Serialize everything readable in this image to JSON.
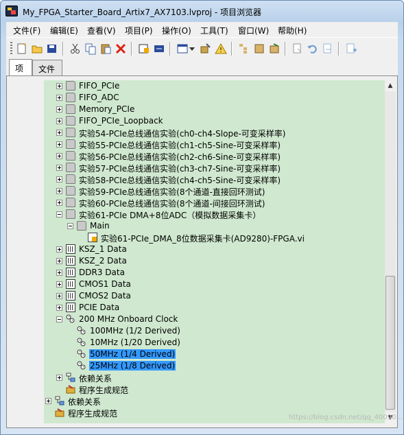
{
  "window": {
    "title": "My_FPGA_Starter_Board_Artix7_AX7103.lvproj - 项目浏览器"
  },
  "menu": [
    "文件(F)",
    "编辑(E)",
    "查看(V)",
    "项目(P)",
    "操作(O)",
    "工具(T)",
    "窗口(W)",
    "帮助(H)"
  ],
  "toolbar": [
    "new-icon",
    "open-icon",
    "save-all-icon",
    "cut-icon",
    "copy-icon",
    "paste-icon",
    "delete-icon",
    "build-icon",
    "deploy-icon",
    "view-icon",
    "dropdown-icon",
    "filter-icon",
    "warning-icon",
    "tree1-icon",
    "tree2-icon",
    "tree3-icon",
    "refresh-icon",
    "undo-icon",
    "redo-icon",
    "add-icon"
  ],
  "tabs": [
    "项",
    "文件"
  ],
  "tree": [
    {
      "label": "FIFO_PCIe",
      "icon": "folder",
      "level": 2,
      "exp": "plus"
    },
    {
      "label": "FIFO_ADC",
      "icon": "folder",
      "level": 2,
      "exp": "plus"
    },
    {
      "label": "Memory_PCIe",
      "icon": "folder",
      "level": 2,
      "exp": "plus"
    },
    {
      "label": "FIFO_PCIe_Loopback",
      "icon": "folder",
      "level": 2,
      "exp": "plus"
    },
    {
      "label": "实验54-PCIe总线通信实验(ch0-ch4-Slope-可变采样率)",
      "icon": "folder",
      "level": 2,
      "exp": "plus"
    },
    {
      "label": "实验55-PCIe总线通信实验(ch1-ch5-Sine-可变采样率)",
      "icon": "folder",
      "level": 2,
      "exp": "plus"
    },
    {
      "label": "实验56-PCIe总线通信实验(ch2-ch6-Sine-可变采样率)",
      "icon": "folder",
      "level": 2,
      "exp": "plus"
    },
    {
      "label": "实验57-PCIe总线通信实验(ch3-ch7-Sine-可变采样率)",
      "icon": "folder",
      "level": 2,
      "exp": "plus"
    },
    {
      "label": "实验58-PCIe总线通信实验(ch4-ch5-Sine-可变采样率)",
      "icon": "folder",
      "level": 2,
      "exp": "plus"
    },
    {
      "label": "实验59-PCIe总线通信实验(8个通道-直接回环测试)",
      "icon": "folder",
      "level": 2,
      "exp": "plus"
    },
    {
      "label": "实验60-PCIe总线通信实验(8个通道-间接回环测试)",
      "icon": "folder",
      "level": 2,
      "exp": "plus"
    },
    {
      "label": "实验61-PCIe DMA+8位ADC（模拟数据采集卡）",
      "icon": "folder",
      "level": 2,
      "exp": "minus"
    },
    {
      "label": "Main",
      "icon": "folder",
      "level": 3,
      "exp": "minus"
    },
    {
      "label": "实验61-PCIe_DMA_8位数据采集卡(AD9280)-FPGA.vi",
      "icon": "vi",
      "level": 4,
      "exp": ""
    },
    {
      "label": "KSZ_1 Data",
      "icon": "chip",
      "level": 2,
      "exp": "plus"
    },
    {
      "label": "KSZ_2 Data",
      "icon": "chip",
      "level": 2,
      "exp": "plus"
    },
    {
      "label": "DDR3 Data",
      "icon": "chip",
      "level": 2,
      "exp": "plus"
    },
    {
      "label": "CMOS1 Data",
      "icon": "chip",
      "level": 2,
      "exp": "plus"
    },
    {
      "label": "CMOS2 Data",
      "icon": "chip",
      "level": 2,
      "exp": "plus"
    },
    {
      "label": "PCIE Data",
      "icon": "chip",
      "level": 2,
      "exp": "plus"
    },
    {
      "label": "200 MHz Onboard Clock",
      "icon": "clock",
      "level": 2,
      "exp": "minus"
    },
    {
      "label": "100MHz (1/2 Derived)",
      "icon": "clock",
      "level": 3,
      "exp": "",
      "selected": false
    },
    {
      "label": "10MHz (1/20 Derived)",
      "icon": "clock",
      "level": 3,
      "exp": "",
      "selected": false
    },
    {
      "label": "50MHz (1/4 Derived)",
      "icon": "clock",
      "level": 3,
      "exp": "",
      "selected": true
    },
    {
      "label": "25MHz (1/8 Derived)",
      "icon": "clock",
      "level": 3,
      "exp": "",
      "selected": true
    },
    {
      "label": "依赖关系",
      "icon": "deps",
      "level": 2,
      "exp": "plus"
    },
    {
      "label": "程序生成规范",
      "icon": "build",
      "level": 2,
      "exp": ""
    },
    {
      "label": "依赖关系",
      "icon": "deps",
      "level": 1,
      "exp": "plus"
    },
    {
      "label": "程序生成规范",
      "icon": "build",
      "level": 1,
      "exp": ""
    }
  ],
  "watermark": "https://blog.csdn.net/qq_40090...",
  "colors": {
    "tree_bg": "#cfe8cf",
    "selection": "#3399ff",
    "titlebar": "#b9d1ea"
  }
}
